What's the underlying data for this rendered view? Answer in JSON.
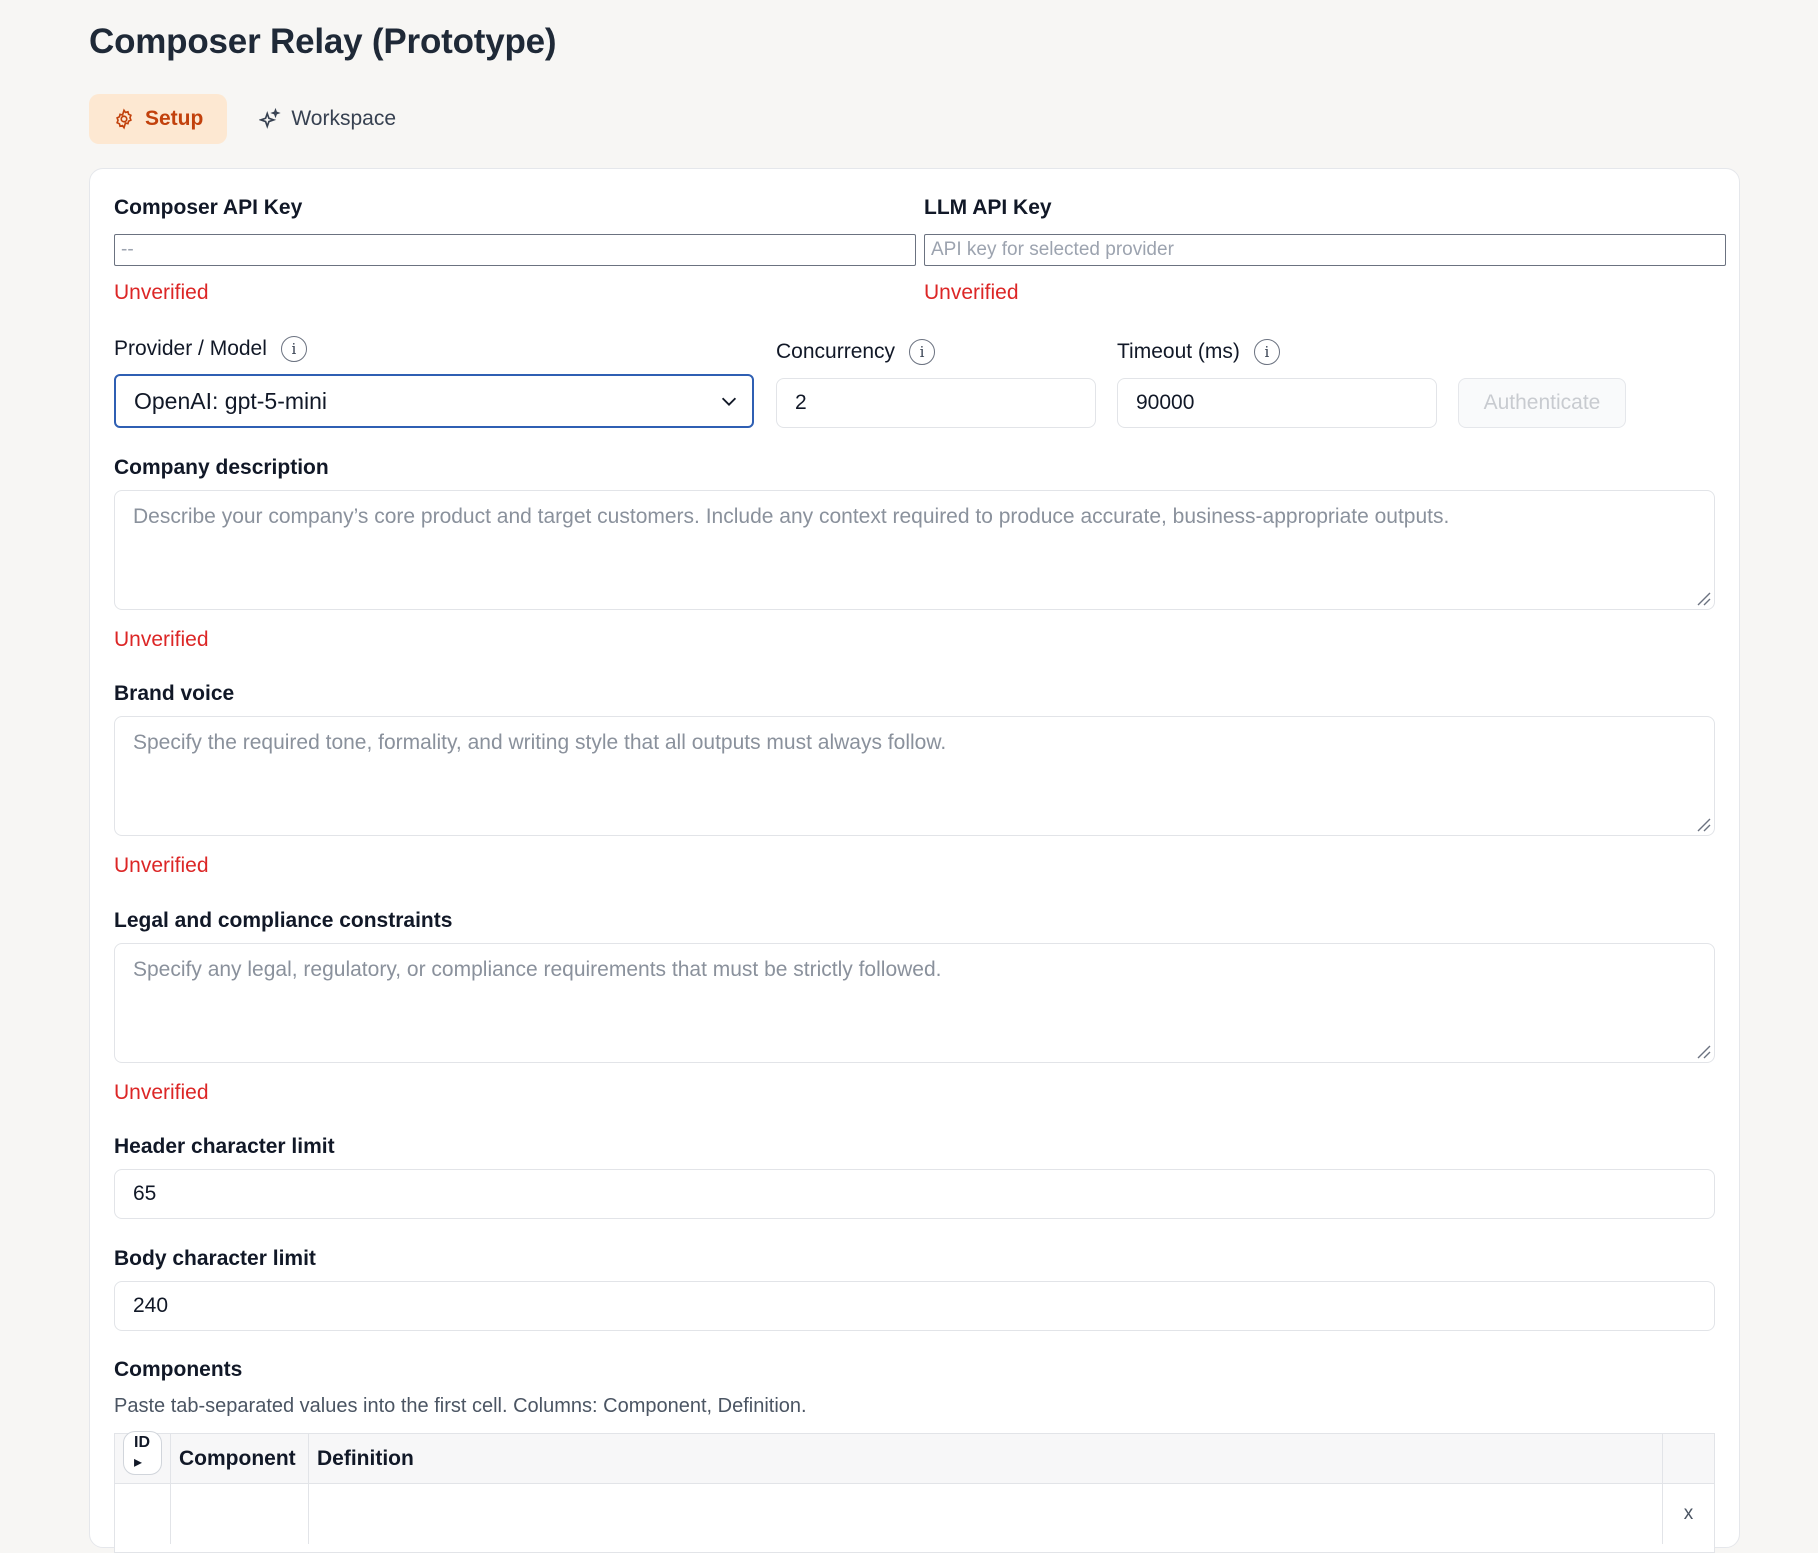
{
  "app": {
    "title": "Composer Relay (Prototype)"
  },
  "tabs": [
    {
      "label": "Setup",
      "icon": "gear-icon",
      "active": true
    },
    {
      "label": "Workspace",
      "icon": "sparkle-icon",
      "active": false
    }
  ],
  "composer_key": {
    "label": "Composer API Key",
    "placeholder": "--",
    "status": "Unverified"
  },
  "llm_key": {
    "label": "LLM API Key",
    "placeholder": "API key for selected provider",
    "status": "Unverified"
  },
  "provider": {
    "label": "Provider / Model",
    "value": "OpenAI: gpt-5-mini"
  },
  "concurrency": {
    "label": "Concurrency",
    "value": "2"
  },
  "timeout": {
    "label": "Timeout (ms)",
    "value": "90000"
  },
  "authenticate": {
    "label": "Authenticate"
  },
  "company": {
    "label": "Company description",
    "placeholder": "Describe your company’s core product and target customers. Include any context required to produce accurate, business-appropriate outputs.",
    "status": "Unverified"
  },
  "brand": {
    "label": "Brand voice",
    "placeholder": "Specify the required tone, formality, and writing style that all outputs must always follow.",
    "status": "Unverified"
  },
  "legal": {
    "label": "Legal and compliance constraints",
    "placeholder": "Specify any legal, regulatory, or compliance requirements that must be strictly followed.",
    "status": "Unverified"
  },
  "header_limit": {
    "label": "Header character limit",
    "value": "65"
  },
  "body_limit": {
    "label": "Body character limit",
    "value": "240"
  },
  "components": {
    "label": "Components",
    "hint": "Paste tab-separated values into the first cell. Columns: Component, Definition.",
    "columns": [
      "ID ▸",
      "Component",
      "Definition"
    ],
    "remove_label": "x"
  },
  "colors": {
    "accent": "#c2410c",
    "accent_bg": "#fde8d2",
    "error": "#dc2626",
    "focus": "#2f5fb3"
  }
}
